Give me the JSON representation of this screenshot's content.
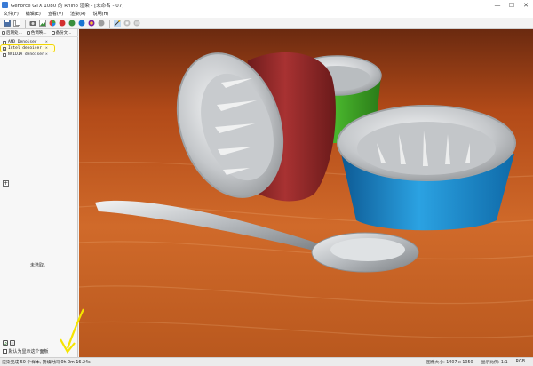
{
  "window": {
    "title": "GeForce GTX 1080 的 Rhino 渲染 - [未命名 - 07]",
    "controls": {
      "minimize": "—",
      "maximize": "☐",
      "close": "✕"
    }
  },
  "menu": [
    "文件(F)",
    "编辑(E)",
    "查看(V)",
    "渲染(R)",
    "说明(H)"
  ],
  "sidebar": {
    "tabs": [
      "后期处...",
      "色调映...",
      "备份文..."
    ],
    "layers": [
      {
        "name": "AMD Denoiser",
        "checked": false,
        "x": "✕"
      },
      {
        "name": "Intel denoiser",
        "checked": true,
        "x": "✕"
      },
      {
        "name": "NVIDIA denoiser",
        "checked": false,
        "x": "✕"
      }
    ],
    "add_label": "+",
    "empty_text": "未选取。",
    "default_label": "默认为显示这个面板"
  },
  "status": {
    "left": "渲染完成 50 个样本, 持续时间 0h 0m 16.24s",
    "image_size": "图像大小: 1407 x 1050",
    "zoom": "显示比例: 1:1",
    "unit": "RGB"
  },
  "colors": {
    "title_bg": "#ffffff",
    "highlight": "#f2d600",
    "arrow": "#f5e400",
    "table": "#c2551c",
    "cup_red": "#9e2a2a",
    "cup_green": "#2f9a1e",
    "cup_blue": "#1d8fd0",
    "metal": "#d4d6d8"
  }
}
